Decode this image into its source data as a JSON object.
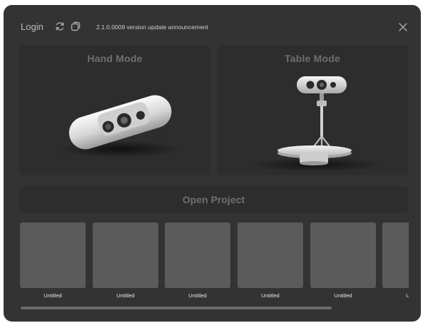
{
  "header": {
    "login_label": "Login",
    "announcement": "2.1.0.0009 version update announcement",
    "icons": [
      "refresh-icon",
      "window-icon",
      "close-icon"
    ]
  },
  "modes": {
    "hand_label": "Hand Mode",
    "table_label": "Table Mode"
  },
  "open_project_label": "Open Project",
  "projects": [
    {
      "name": "Untitled"
    },
    {
      "name": "Untitled"
    },
    {
      "name": "Untitled"
    },
    {
      "name": "Untitled"
    },
    {
      "name": "Untitled"
    },
    {
      "name": "Untitled"
    }
  ],
  "colors": {
    "window_bg": "#333333",
    "card_bg": "#2d2d2d",
    "thumb_bg": "#5b5b5b",
    "muted_text": "#6f6f6f"
  }
}
